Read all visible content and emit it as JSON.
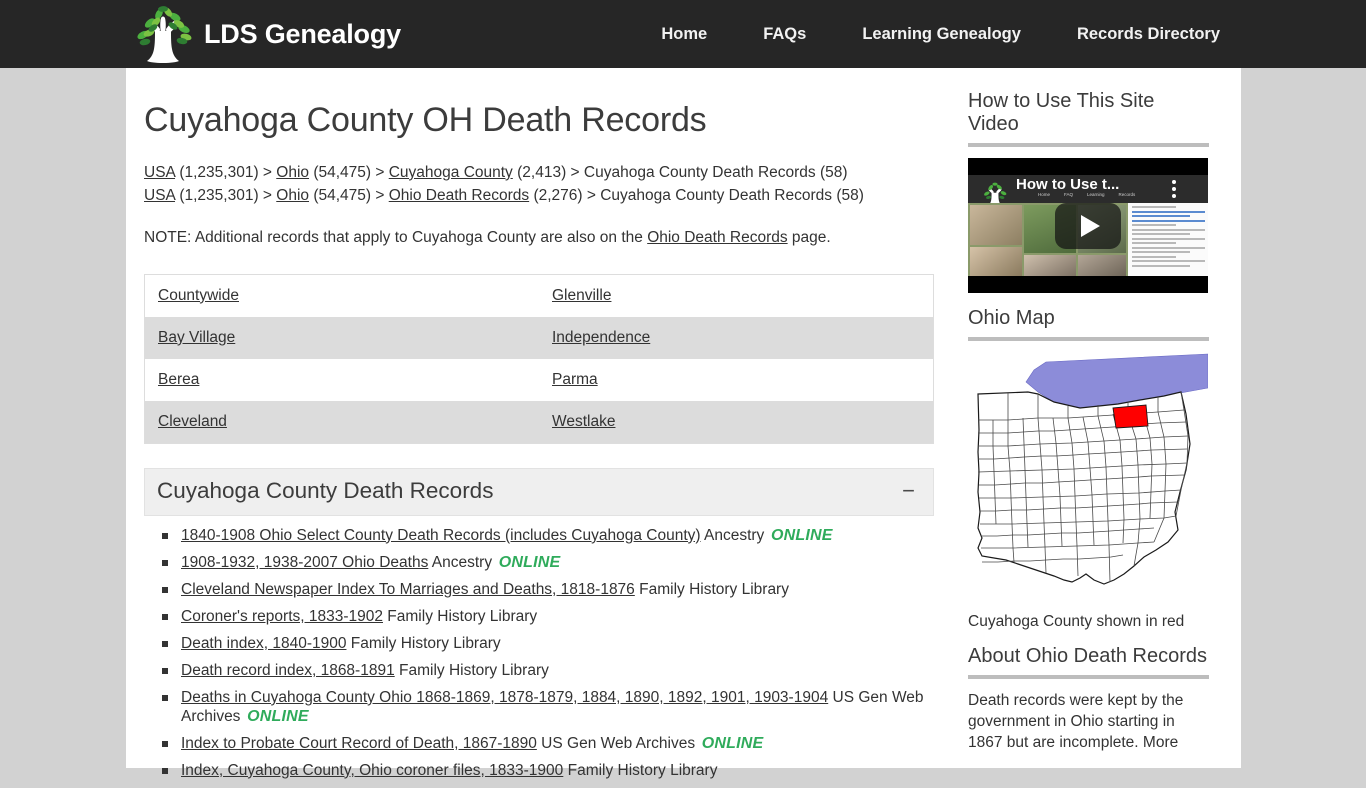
{
  "header": {
    "brand_name": "LDS Genealogy",
    "logo_icon": "tree-logo-icon",
    "nav": [
      {
        "label": "Home"
      },
      {
        "label": "FAQs"
      },
      {
        "label": "Learning Genealogy"
      },
      {
        "label": "Records Directory"
      }
    ]
  },
  "main": {
    "page_title": "Cuyahoga County OH Death Records",
    "breadcrumbs": [
      [
        {
          "text": "USA",
          "link": true
        },
        {
          "text": " (1,235,301) > ",
          "link": false
        },
        {
          "text": "Ohio",
          "link": true
        },
        {
          "text": " (54,475) > ",
          "link": false
        },
        {
          "text": "Cuyahoga County",
          "link": true
        },
        {
          "text": " (2,413) > Cuyahoga County Death Records (58)",
          "link": false
        }
      ],
      [
        {
          "text": "USA",
          "link": true
        },
        {
          "text": " (1,235,301) > ",
          "link": false
        },
        {
          "text": "Ohio",
          "link": true
        },
        {
          "text": " (54,475) > ",
          "link": false
        },
        {
          "text": "Ohio Death Records",
          "link": true
        },
        {
          "text": " (2,276) > Cuyahoga County Death Records (58)",
          "link": false
        }
      ]
    ],
    "note": {
      "before": "NOTE: Additional records that apply to Cuyahoga County are also on the ",
      "link": "Ohio Death Records",
      "after": " page."
    },
    "cities_table": {
      "rows": [
        [
          "Countywide",
          "Glenville"
        ],
        [
          "Bay Village",
          "Independence"
        ],
        [
          "Berea",
          "Parma"
        ],
        [
          "Cleveland",
          "Westlake"
        ]
      ]
    },
    "accordion": {
      "title": "Cuyahoga County Death Records",
      "toggle_glyph": "−",
      "toggle_state": "expanded",
      "records": [
        {
          "link": "1840-1908 Ohio Select County Death Records (includes Cuyahoga County)",
          "source": "Ancestry",
          "badge": "ONLINE"
        },
        {
          "link": "1908-1932, 1938-2007 Ohio Deaths",
          "source": "Ancestry",
          "badge": "ONLINE"
        },
        {
          "link": "Cleveland Newspaper Index To Marriages and Deaths, 1818-1876",
          "source": "Family History Library",
          "badge": ""
        },
        {
          "link": "Coroner's reports, 1833-1902",
          "source": "Family History Library",
          "badge": ""
        },
        {
          "link": "Death index, 1840-1900",
          "source": "Family History Library",
          "badge": ""
        },
        {
          "link": "Death record index, 1868-1891",
          "source": "Family History Library",
          "badge": ""
        },
        {
          "link": "Deaths in Cuyahoga County Ohio 1868-1869, 1878-1879, 1884, 1890, 1892, 1901, 1903-1904",
          "source": "US Gen Web Archives",
          "badge": "ONLINE"
        },
        {
          "link": "Index to Probate Court Record of Death, 1867-1890",
          "source": "US Gen Web Archives",
          "badge": "ONLINE"
        },
        {
          "link": "Index, Cuyahoga County, Ohio coroner files, 1833-1900",
          "source": "Family History Library",
          "badge": ""
        }
      ]
    }
  },
  "sidebar": {
    "video_section": {
      "heading": "How to Use This Site Video",
      "video_title": "How to Use t...",
      "play_icon": "play-button-icon",
      "menu_icon": "kebab-menu-icon"
    },
    "map_section": {
      "heading": "Ohio Map",
      "caption": "Cuyahoga County shown in red",
      "highlight_color": "#ff0000",
      "water_color": "#8c8cd9"
    },
    "about_section": {
      "heading": "About Ohio Death Records",
      "text": "Death records were kept by the government in Ohio starting in 1867 but are incomplete. More"
    }
  },
  "colors": {
    "topbar_bg": "#262626",
    "page_bg": "#d2d2d2",
    "canvas_bg": "#ffffff",
    "online_green": "#2fab5b",
    "table_stripe": "#dcdcdc",
    "accordion_bg": "#efefef"
  }
}
